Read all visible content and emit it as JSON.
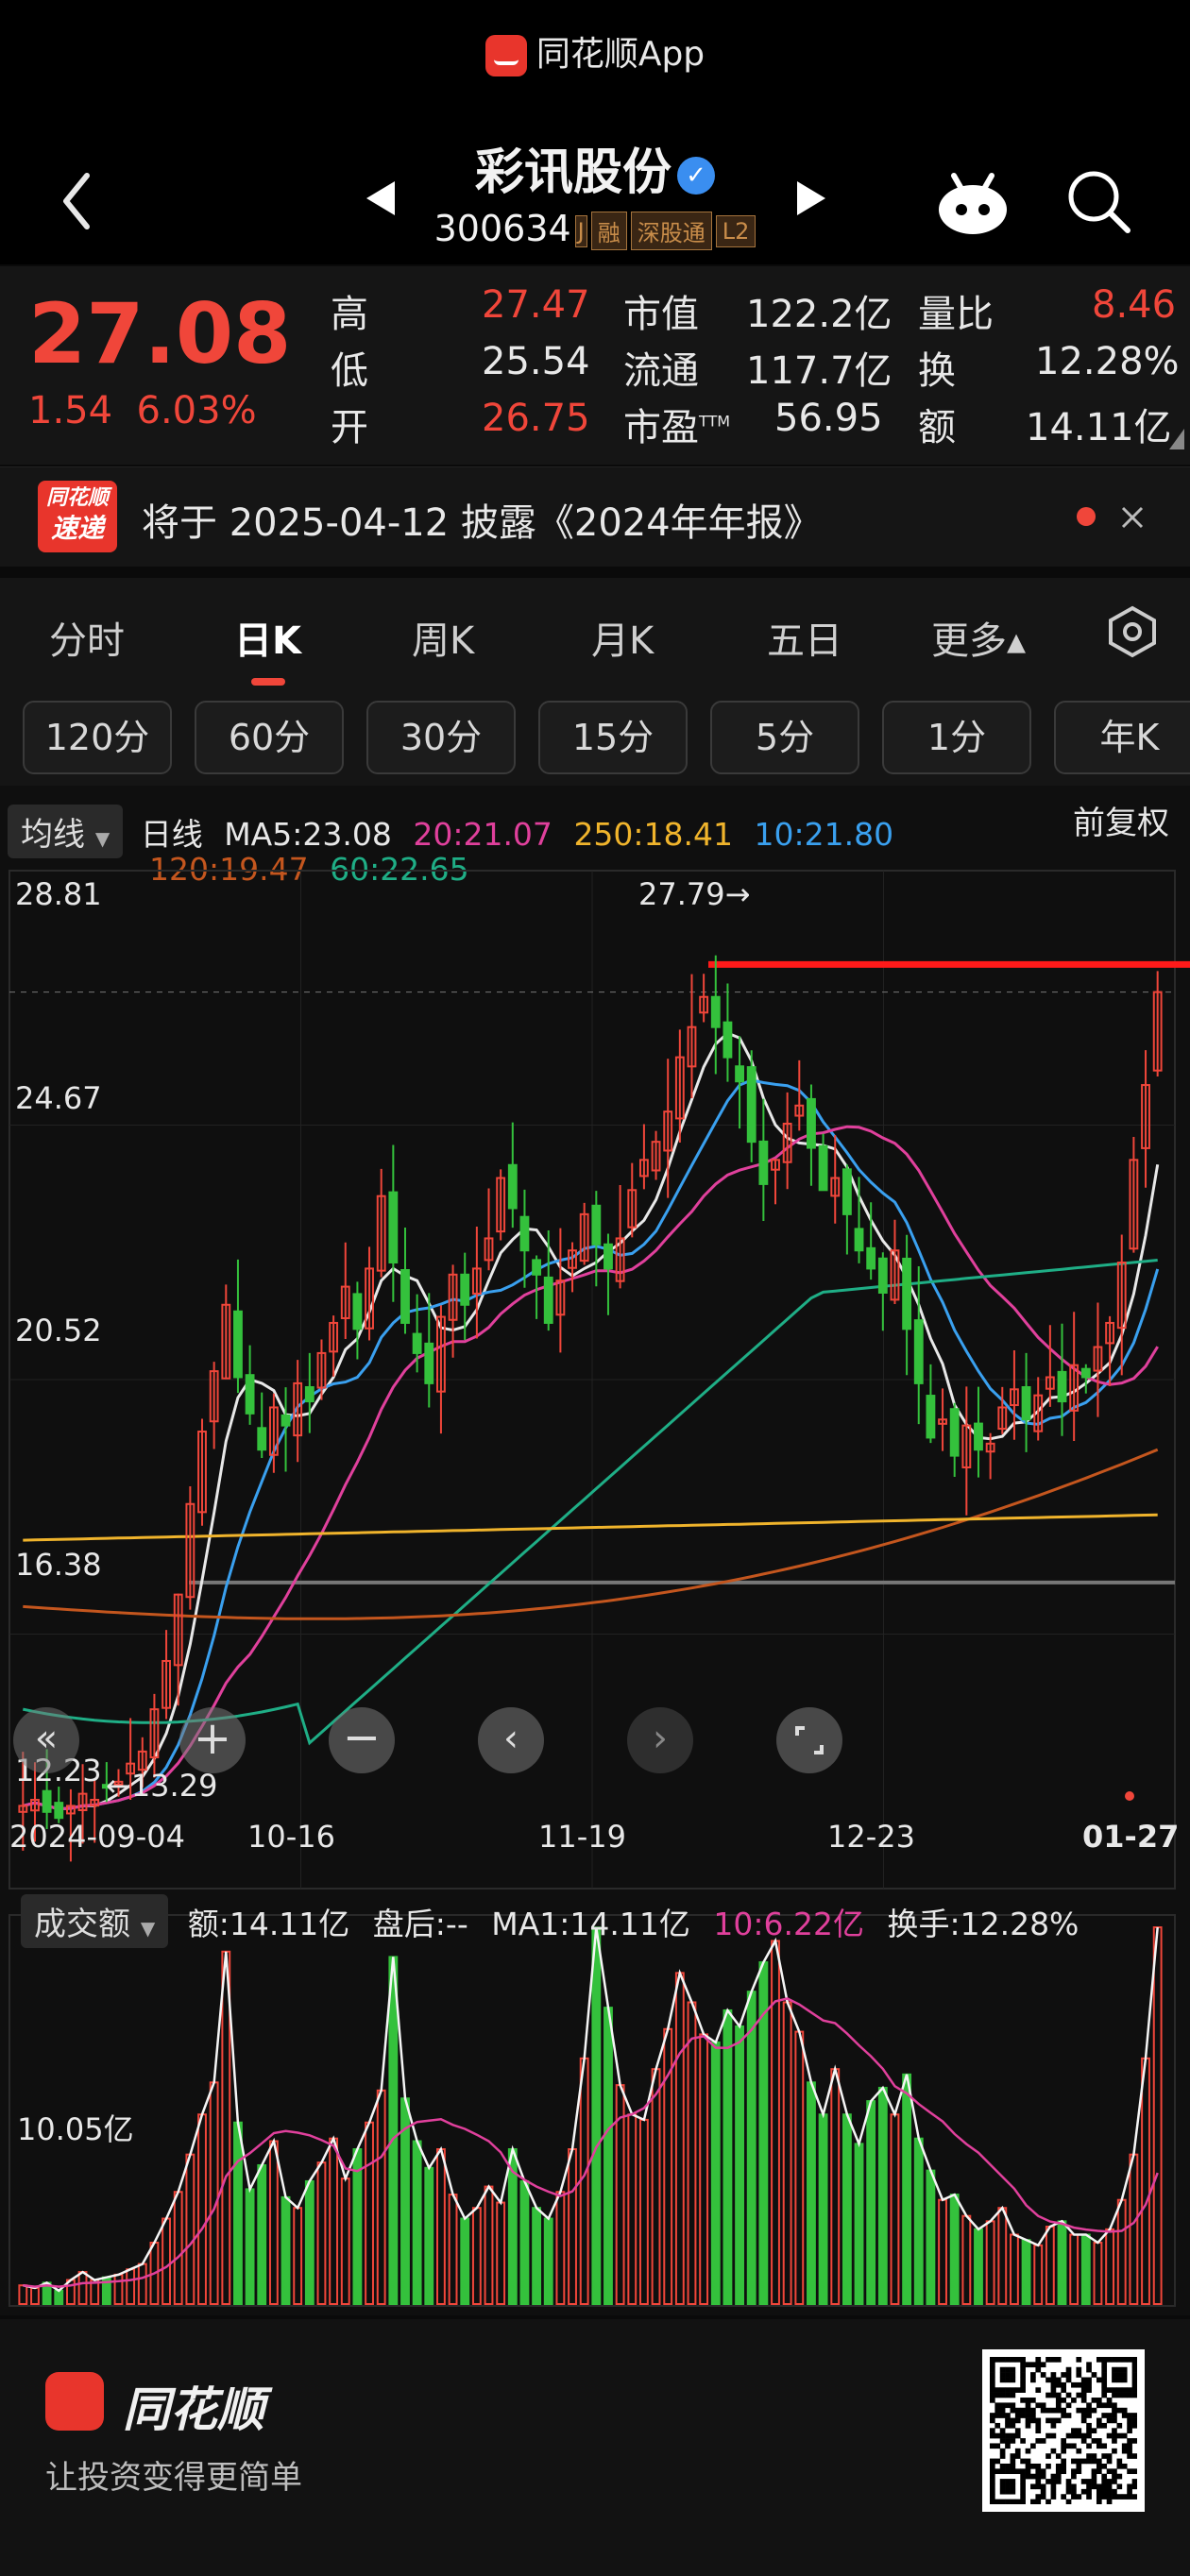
{
  "app_strip": "同花顺App",
  "header": {
    "stock_name": "彩讯股份",
    "code": "300634",
    "tags": [
      "融",
      "深股通",
      "L2"
    ]
  },
  "quote": {
    "price": "27.08",
    "change": "1.54",
    "change_pct": "6.03%",
    "high_label": "高",
    "high": "27.47",
    "low_label": "低",
    "low": "25.54",
    "open_label": "开",
    "open": "26.75",
    "mcap_label": "市值",
    "mcap": "122.2亿",
    "float_label": "流通",
    "float": "117.7亿",
    "pe_label": "市盈",
    "pe_sup": "TTM",
    "pe": "56.95",
    "vol_ratio_label": "量比",
    "vol_ratio": "8.46",
    "turnover_label": "换",
    "turnover": "12.28%",
    "amount_label": "额",
    "amount": "14.11亿"
  },
  "announce": {
    "badge_l1": "同花顺",
    "badge_l2": "速递",
    "text": "将于 2025-04-12 披露《2024年年报》"
  },
  "tabs": [
    "分时",
    "日K",
    "周K",
    "月K",
    "五日",
    "更多▴"
  ],
  "minute_buttons": [
    "120分",
    "60分",
    "30分",
    "15分",
    "5分",
    "1分",
    "年K"
  ],
  "ma_legend": {
    "selector": "均线",
    "period": "日线",
    "ma5": "MA5:23.08",
    "ma20": "20:21.07",
    "ma250": "250:18.41",
    "ma10": "10:21.80",
    "ma120": "120:19.47",
    "ma60": "60:22.65",
    "adjust": "前复权"
  },
  "price_axis": [
    "28.81",
    "24.67",
    "20.52",
    "16.38",
    "12.23"
  ],
  "annotations": {
    "high": "27.79→",
    "low": "←13.29"
  },
  "date_axis": [
    "2024-09-04",
    "10-16",
    "11-19",
    "12-23",
    "01-27"
  ],
  "volume_legend": {
    "selector": "成交额",
    "amount": "额:14.11亿",
    "after": "盘后:--",
    "ma1": "MA1:14.11亿",
    "ma10": "10:6.22亿",
    "turnover": "换手:12.28%",
    "axis_label": "10.05亿"
  },
  "footer": {
    "brand": "同花顺",
    "slogan": "让投资变得更简单"
  },
  "colors": {
    "up": "#f0463a",
    "down": "#34c13c",
    "ma5": "#e8e8e8",
    "ma10": "#3aa0ef",
    "ma20": "#e0409c",
    "ma60": "#1fae86",
    "ma120": "#c4561e",
    "ma250": "#f0b42c"
  },
  "chart_data": {
    "type": "candlestick",
    "x": [
      "2024-09-04",
      "2024-09-05",
      "2024-09-06",
      "2024-09-09",
      "2024-09-10",
      "2024-09-11",
      "2024-09-12",
      "2024-09-13",
      "2024-09-18",
      "2024-09-19",
      "2024-09-20",
      "2024-09-23",
      "2024-09-24",
      "2024-09-25",
      "2024-09-26",
      "2024-09-27",
      "2024-09-30",
      "2024-10-08",
      "2024-10-09",
      "2024-10-10",
      "2024-10-11",
      "2024-10-14",
      "2024-10-15",
      "2024-10-16",
      "2024-10-17",
      "2024-10-18",
      "2024-10-21",
      "2024-10-22",
      "2024-10-23",
      "2024-10-24",
      "2024-10-25",
      "2024-10-28",
      "2024-10-29",
      "2024-10-30",
      "2024-10-31",
      "2024-11-01",
      "2024-11-04",
      "2024-11-05",
      "2024-11-06",
      "2024-11-07",
      "2024-11-08",
      "2024-11-11",
      "2024-11-12",
      "2024-11-13",
      "2024-11-14",
      "2024-11-15",
      "2024-11-18",
      "2024-11-19",
      "2024-11-20",
      "2024-11-21",
      "2024-11-22",
      "2024-11-25",
      "2024-11-26",
      "2024-11-27",
      "2024-11-28",
      "2024-11-29",
      "2024-12-02",
      "2024-12-03",
      "2024-12-04",
      "2024-12-05",
      "2024-12-06",
      "2024-12-09",
      "2024-12-10",
      "2024-12-11",
      "2024-12-12",
      "2024-12-13",
      "2024-12-16",
      "2024-12-17",
      "2024-12-18",
      "2024-12-19",
      "2024-12-20",
      "2024-12-23",
      "2024-12-24",
      "2024-12-25",
      "2024-12-26",
      "2024-12-27",
      "2024-12-30",
      "2024-12-31",
      "2025-01-02",
      "2025-01-03",
      "2025-01-06",
      "2025-01-07",
      "2025-01-08",
      "2025-01-09",
      "2025-01-10",
      "2025-01-13",
      "2025-01-14",
      "2025-01-15",
      "2025-01-16",
      "2025-01-17",
      "2025-01-20",
      "2025-01-21",
      "2025-01-22",
      "2025-01-23",
      "2025-01-24",
      "2025-01-27"
    ],
    "close": [
      13.6,
      13.7,
      13.5,
      13.4,
      13.6,
      13.8,
      13.7,
      13.9,
      14.0,
      14.3,
      14.5,
      15.2,
      16.0,
      17.1,
      18.6,
      19.8,
      20.8,
      21.9,
      20.7,
      20.1,
      19.5,
      20.2,
      19.9,
      20.6,
      20.3,
      21.1,
      21.6,
      22.2,
      21.5,
      22.5,
      23.7,
      22.6,
      21.6,
      21.1,
      20.6,
      21.7,
      22.4,
      21.9,
      22.5,
      23.0,
      24.0,
      23.5,
      22.8,
      22.4,
      21.6,
      22.3,
      22.8,
      23.4,
      22.9,
      22.5,
      23.0,
      23.8,
      24.3,
      24.6,
      25.1,
      26.0,
      26.5,
      27.0,
      26.5,
      26.0,
      25.6,
      24.6,
      23.9,
      24.3,
      24.9,
      25.2,
      24.5,
      23.8,
      24.0,
      23.4,
      22.8,
      22.5,
      22.1,
      22.8,
      21.5,
      20.6,
      19.7,
      20.0,
      19.4,
      19.9,
      19.5,
      19.6,
      20.2,
      20.5,
      20.0,
      20.4,
      20.7,
      20.3,
      20.9,
      20.7,
      21.2,
      21.6,
      22.6,
      24.3,
      25.54,
      27.08
    ],
    "amount_yi": [
      0.7,
      0.6,
      0.8,
      0.5,
      0.9,
      1.2,
      0.9,
      1.0,
      1.1,
      1.3,
      1.5,
      2.3,
      3.2,
      4.2,
      5.6,
      7.1,
      8.3,
      13.2,
      6.8,
      4.3,
      5.2,
      6.1,
      4.0,
      3.6,
      4.6,
      5.3,
      6.2,
      4.7,
      5.8,
      6.8,
      8.0,
      13.0,
      7.7,
      6.1,
      5.1,
      5.8,
      4.1,
      3.2,
      3.6,
      4.4,
      3.8,
      5.8,
      4.6,
      3.6,
      3.2,
      4.2,
      5.8,
      9.2,
      14.1,
      11.1,
      8.2,
      7.1,
      6.9,
      8.8,
      10.3,
      12.4,
      11.3,
      10.1,
      9.8,
      11.0,
      10.4,
      11.7,
      12.8,
      13.6,
      11.3,
      10.2,
      8.3,
      7.1,
      8.8,
      7.1,
      6.0,
      7.6,
      8.1,
      7.1,
      8.6,
      6.2,
      5.0,
      3.9,
      4.1,
      3.3,
      2.8,
      3.1,
      3.6,
      2.6,
      2.4,
      2.2,
      2.9,
      3.1,
      2.6,
      2.6,
      2.3,
      2.8,
      3.9,
      5.6,
      9.2,
      14.11
    ]
  }
}
